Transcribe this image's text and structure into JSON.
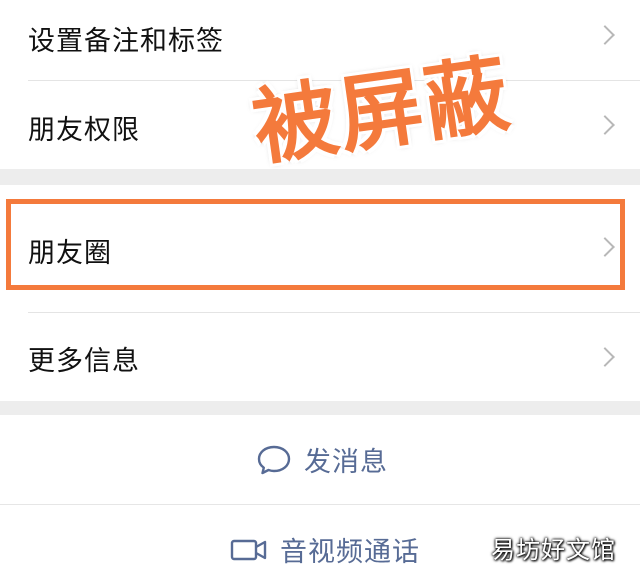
{
  "menu": {
    "remark_tags": "设置备注和标签",
    "friend_permissions": "朋友权限",
    "moments": "朋友圈",
    "more_info": "更多信息"
  },
  "actions": {
    "send_message": "发消息",
    "video_call": "音视频通话"
  },
  "overlay": {
    "stamp_text": "被屏蔽",
    "watermark": "易坊好文馆"
  },
  "colors": {
    "highlight": "#f47a3c",
    "link_blue": "#576b95",
    "background": "#ededed"
  },
  "icons": {
    "chevron": "chevron-right-icon",
    "message": "chat-bubble-icon",
    "video": "video-camera-icon"
  }
}
